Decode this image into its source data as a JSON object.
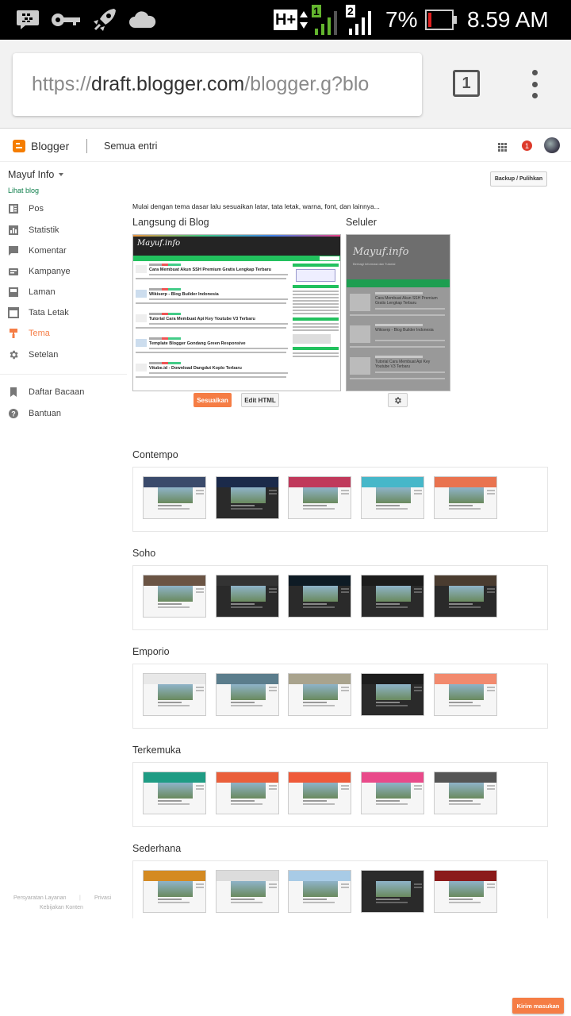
{
  "status": {
    "battery": "7%",
    "time": "8.59 AM",
    "network": "H+",
    "sim1": "1",
    "sim2": "2"
  },
  "browser": {
    "url_scheme": "https://",
    "url_domain": "draft.blogger.com",
    "url_path": "/blogger.g?blo",
    "tab_count": "1"
  },
  "header": {
    "brand": "Blogger",
    "section": "Semua entri",
    "notif_count": "1"
  },
  "sidebar": {
    "blog_name": "Mayuf Info",
    "view_blog": "Lihat blog",
    "items": [
      {
        "label": "Pos",
        "icon": "posts-icon"
      },
      {
        "label": "Statistik",
        "icon": "stats-icon"
      },
      {
        "label": "Komentar",
        "icon": "comment-icon"
      },
      {
        "label": "Kampanye",
        "icon": "campaign-icon"
      },
      {
        "label": "Laman",
        "icon": "page-icon"
      },
      {
        "label": "Tata Letak",
        "icon": "layout-icon"
      },
      {
        "label": "Tema",
        "icon": "theme-icon"
      },
      {
        "label": "Setelan",
        "icon": "gear-icon"
      }
    ],
    "items2": [
      {
        "label": "Daftar Bacaan",
        "icon": "bookmark-icon"
      },
      {
        "label": "Bantuan",
        "icon": "help-icon"
      }
    ],
    "footer": {
      "terms": "Persyaratan Layanan",
      "privacy": "Privasi",
      "content_policy": "Kebijakan Konten"
    }
  },
  "main": {
    "backup_label": "Backup / Pulihkan",
    "intro": "Mulai dengan tema dasar lalu sesuaikan latar, tata letak, warna, font, dan lainnya...",
    "live_label": "Langsung di Blog",
    "mobile_label": "Seluler",
    "customize_label": "Sesuaikan",
    "edit_html_label": "Edit HTML",
    "preview": {
      "logo": "Mayuf.info",
      "mobile_subtitle": "Berbagi Informasi dan Tutorial",
      "posts": [
        "Cara Membuat Akun SSH Premium Gratis Lengkap Terbaru",
        "Wikiserp - Blog Builder Indonesia",
        "Tutorial Cara Membuat Api Key Youtube V3 Terbaru",
        "Template Blogger Gondang Green Responsive",
        "Vitube.id - Download Dangdut Koplo Terbaru"
      ]
    },
    "sections": [
      {
        "title": "Contempo",
        "colors": [
          "#3a4a6b",
          "#1b2a4a",
          "#c0395b",
          "#46b7c9",
          "#e9734f"
        ]
      },
      {
        "title": "Soho",
        "colors": [
          "#6b5444",
          "#333333",
          "#0e1b25",
          "#1c1c1c",
          "#4a3c30"
        ]
      },
      {
        "title": "Emporio",
        "colors": [
          "#e8e8e8",
          "#5b7d8c",
          "#a9a38d",
          "#1d1d1d",
          "#f28a6e"
        ]
      },
      {
        "title": "Terkemuka",
        "colors": [
          "#1f9c84",
          "#ea5f3b",
          "#ef5a3a",
          "#e94a8a",
          "#555555"
        ]
      },
      {
        "title": "Sederhana",
        "colors": [
          "#d48a22",
          "#dcdcdc",
          "#a8cbe6",
          "#2b2b2b",
          "#8b1a1a"
        ]
      }
    ],
    "feedback_label": "Kirim masukan"
  },
  "colors": {
    "accent": "#f57d45",
    "brand": "#f57d00",
    "green": "#22c15e"
  }
}
